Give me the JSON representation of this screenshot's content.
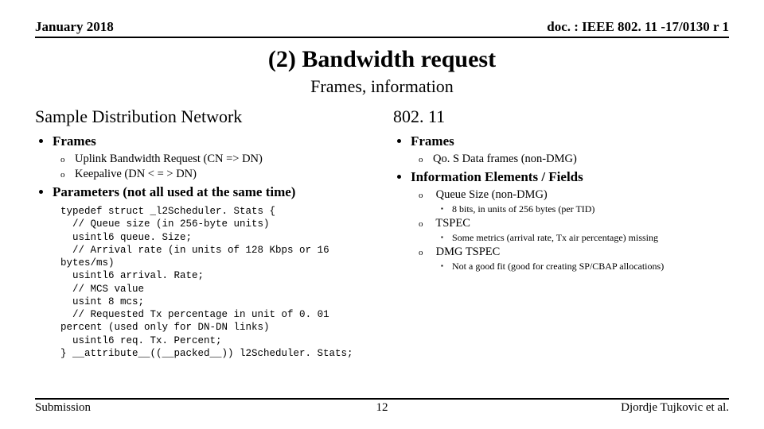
{
  "header": {
    "left": "January 2018",
    "right": "doc. : IEEE 802. 11 -17/0130 r 1"
  },
  "title": "(2) Bandwidth request",
  "subtitle": "Frames, information",
  "left": {
    "heading": "Sample Distribution Network",
    "sec1": {
      "label": "Frames",
      "items": [
        "Uplink Bandwidth Request (CN => DN)",
        "Keepalive (DN < = > DN)"
      ]
    },
    "sec2": {
      "label": "Parameters (not all used at the same time)",
      "code": "typedef struct _l2Scheduler. Stats {\n  // Queue size (in 256-byte units)\n  usintl6 queue. Size;\n  // Arrival rate (in units of 128 Kbps or 16\nbytes/ms)\n  usintl6 arrival. Rate;\n  // MCS value\n  usint 8 mcs;\n  // Requested Tx percentage in unit of 0. 01\npercent (used only for DN-DN links)\n  usintl6 req. Tx. Percent;\n} __attribute__((__packed__)) l2Scheduler. Stats;"
    }
  },
  "right": {
    "heading": "802. 11",
    "sec1": {
      "label": "Frames",
      "items": [
        "Qo. S Data frames (non-DMG)"
      ]
    },
    "sec2": {
      "label": "Information Elements / Fields",
      "i1": {
        "label": "Queue Size (non-DMG)",
        "sub": "8 bits, in units of 256 bytes (per TID)"
      },
      "i2": {
        "label": "TSPEC",
        "sub": "Some metrics (arrival rate, Tx air percentage) missing"
      },
      "i3": {
        "label": "DMG TSPEC",
        "sub": "Not a good fit (good for creating SP/CBAP allocations)"
      }
    }
  },
  "footer": {
    "left": "Submission",
    "center": "12",
    "right": "Djordje Tujkovic et al."
  }
}
